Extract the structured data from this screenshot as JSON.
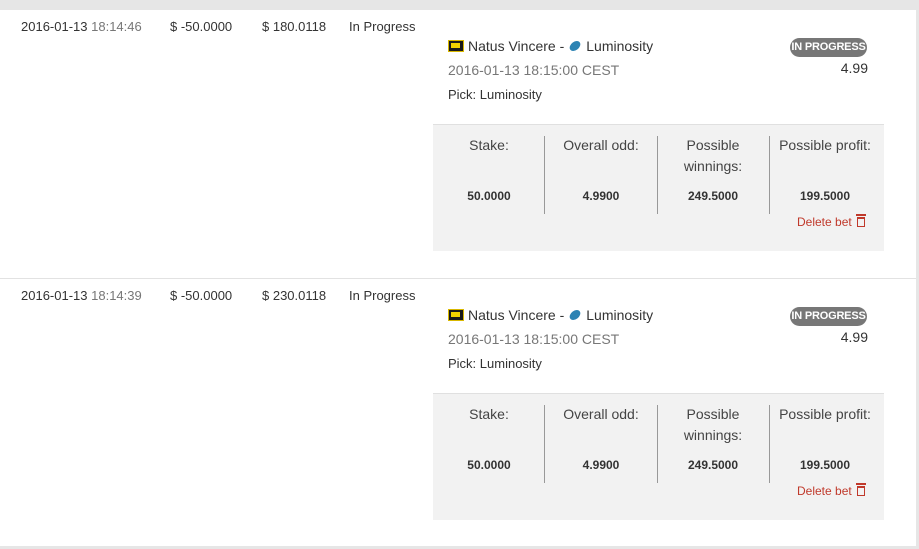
{
  "bets": [
    {
      "date": "2016-01-13",
      "time": "18:14:46",
      "amount": "$ -50.0000",
      "balance": "$ 180.0118",
      "status": "In Progress",
      "team1": "Natus Vincere",
      "separator": "-",
      "team2": "Luminosity",
      "match_time": "2016-01-13 18:15:00 CEST",
      "pick": "Pick: Luminosity",
      "badge": "IN PROGRESS",
      "odd": "4.99",
      "stake_label": "Stake:",
      "stake": "50.0000",
      "overall_label": "Overall odd:",
      "overall": "4.9900",
      "winnings_label": "Possible winnings:",
      "winnings": "249.5000",
      "profit_label": "Possible profit:",
      "profit": "199.5000",
      "delete_label": "Delete bet"
    },
    {
      "date": "2016-01-13",
      "time": "18:14:39",
      "amount": "$ -50.0000",
      "balance": "$ 230.0118",
      "status": "In Progress",
      "team1": "Natus Vincere",
      "separator": "-",
      "team2": "Luminosity",
      "match_time": "2016-01-13 18:15:00 CEST",
      "pick": "Pick: Luminosity",
      "badge": "IN PROGRESS",
      "odd": "4.99",
      "stake_label": "Stake:",
      "stake": "50.0000",
      "overall_label": "Overall odd:",
      "overall": "4.9900",
      "winnings_label": "Possible winnings:",
      "winnings": "249.5000",
      "profit_label": "Possible profit:",
      "profit": "199.5000",
      "delete_label": "Delete bet"
    }
  ],
  "icons": {
    "team1_logo": "navi-logo-icon",
    "team2_logo": "luminosity-logo-icon",
    "delete": "trash-icon"
  },
  "colors": {
    "badge_bg": "#777777",
    "delete_text": "#c0392b",
    "box_bg": "#f2f2f2"
  }
}
